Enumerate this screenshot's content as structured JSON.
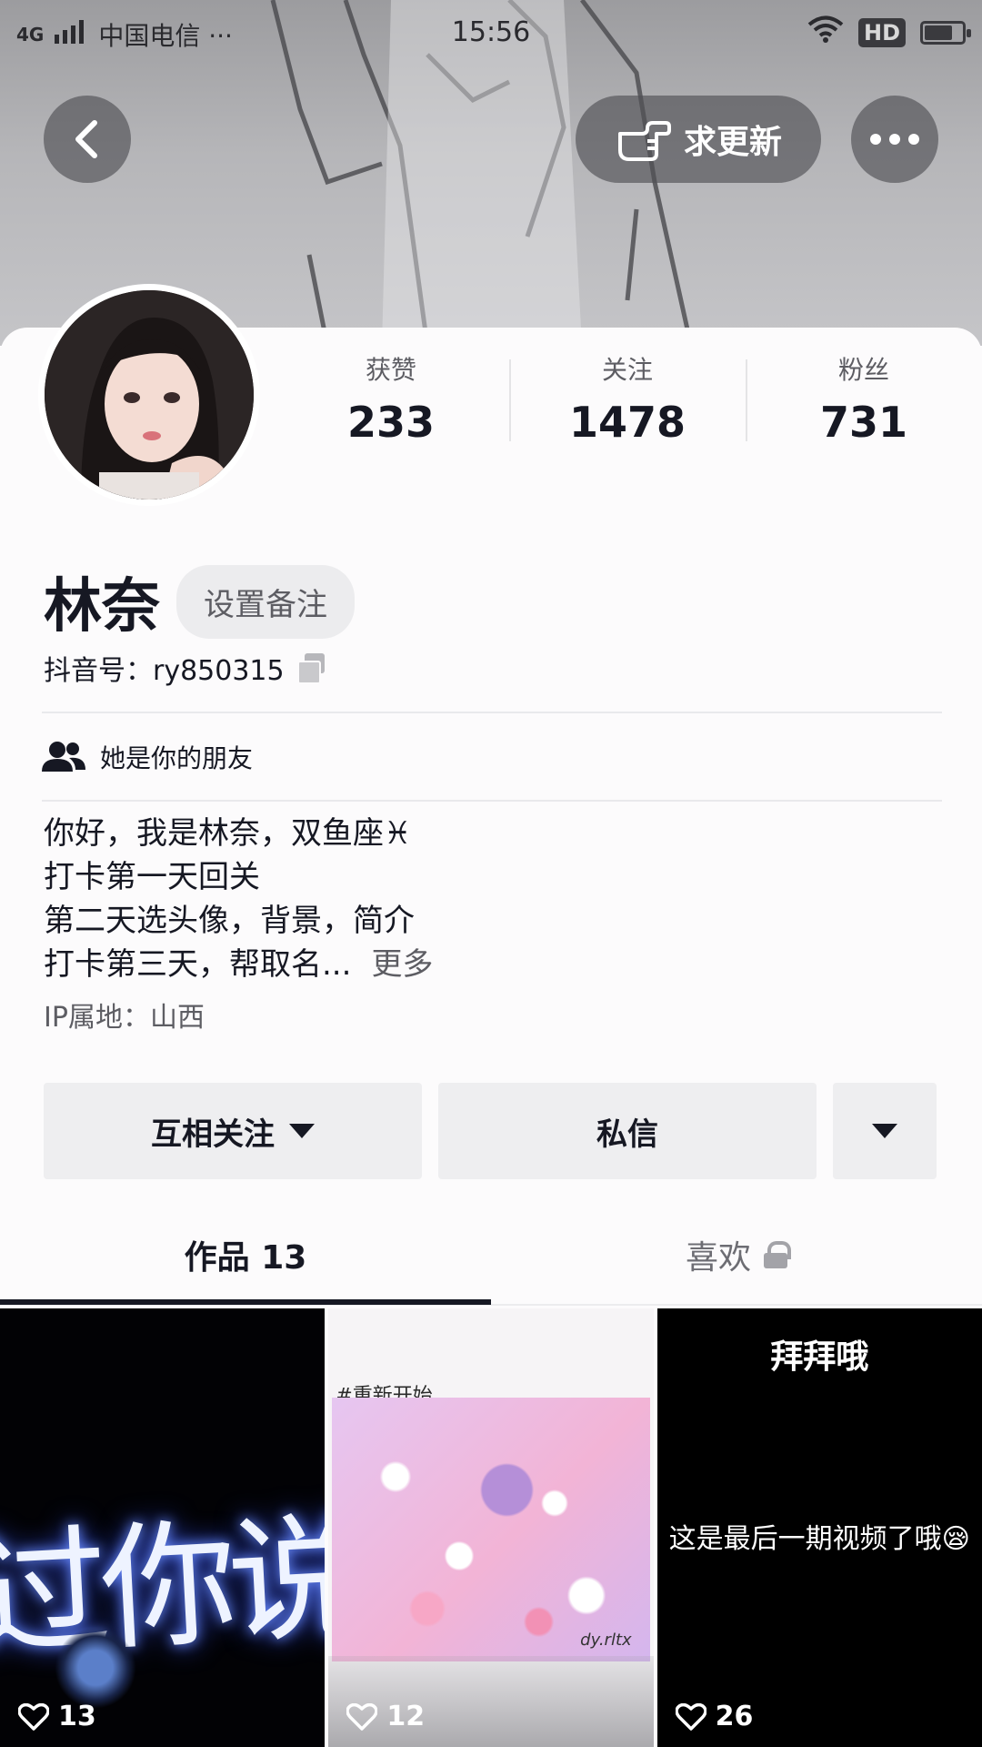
{
  "status_bar": {
    "network": "4G",
    "carrier": "中国电信 ···",
    "time": "15:56",
    "hd": "HD"
  },
  "header": {
    "update_label": "求更新"
  },
  "profile": {
    "stats": [
      {
        "label": "获赞",
        "value": "233"
      },
      {
        "label": "关注",
        "value": "1478"
      },
      {
        "label": "粉丝",
        "value": "731"
      }
    ],
    "name": "林奈",
    "remark_button": "设置备注",
    "douyin_id": "抖音号：ry850315",
    "friend_note": "她是你的朋友",
    "bio_lines": [
      "你好，我是林奈，双鱼座♓",
      "打卡第一天回关",
      "第二天选头像，背景，简介",
      "打卡第三天，帮取名..."
    ],
    "bio_more": "更多",
    "ip": "IP属地：山西"
  },
  "actions": {
    "follow_label": "互相关注",
    "message_label": "私信"
  },
  "tabs": {
    "works": "作品 13",
    "likes": "喜欢"
  },
  "videos": [
    {
      "overlay_text": "过你说",
      "likes": "13"
    },
    {
      "tag_text": "#重新开始",
      "watermark": "dy.rltx",
      "likes": "12"
    },
    {
      "title": "拜拜哦",
      "caption": "这是最后一期视频了哦😪",
      "likes": "26"
    }
  ],
  "colors": {
    "text_primary": "#161823",
    "text_secondary": "#5d5d63",
    "button_bg": "#eeeef0"
  }
}
